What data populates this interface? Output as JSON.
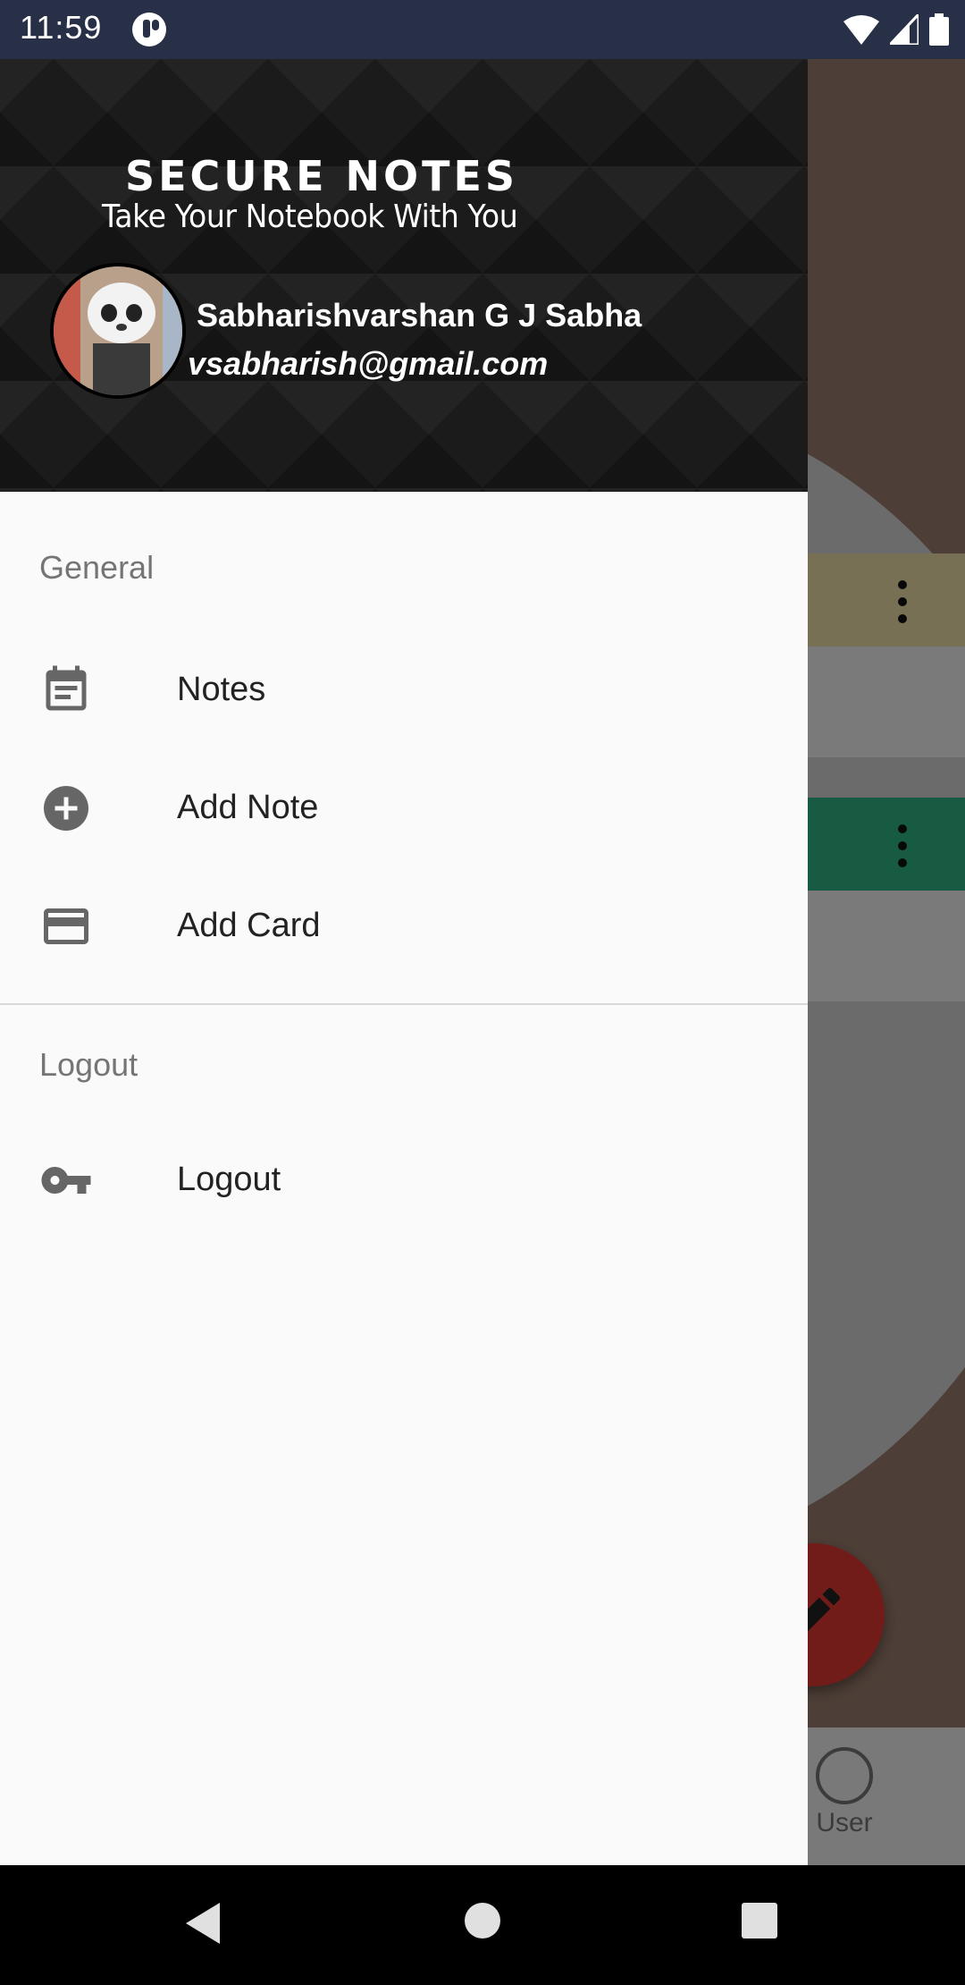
{
  "status_bar": {
    "time": "11:59"
  },
  "header": {
    "app_title": "SECURE NOTES",
    "tagline": "Take Your Notebook With You",
    "user_name": "Sabharishvarshan G J Sabha",
    "user_email": "vsabharish@gmail.com"
  },
  "menu": {
    "general_label": "General",
    "items": [
      {
        "label": "Notes",
        "icon": "notes-icon"
      },
      {
        "label": "Add Note",
        "icon": "add-circle-icon"
      },
      {
        "label": "Add Card",
        "icon": "credit-card-icon"
      }
    ],
    "logout_section_label": "Logout",
    "logout_item": {
      "label": "Logout",
      "icon": "key-icon"
    }
  },
  "background": {
    "bottom_nav_user_label": "User"
  },
  "colors": {
    "status_bar": "#283048",
    "drawer_header": "#1b1b1b",
    "drawer_bg": "#fafafa",
    "fab": "#e53935"
  }
}
